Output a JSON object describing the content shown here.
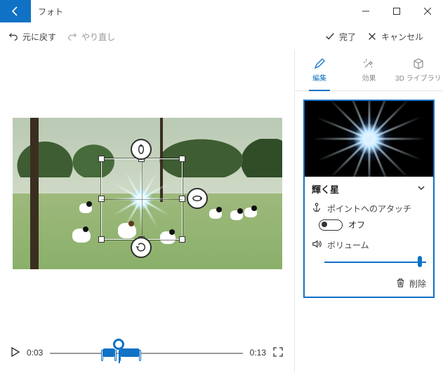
{
  "app_title": "フォト",
  "cmd": {
    "undo": "元に戻す",
    "redo": "やり直し",
    "done": "完了",
    "cancel": "キャンセル"
  },
  "timeline": {
    "current": "0:03",
    "total": "0:13"
  },
  "tabs": {
    "edit": "編集",
    "effects": "効果",
    "library3d": "3D ライブラリ"
  },
  "effect": {
    "name": "輝く星",
    "attach_label": "ポイントへのアタッチ",
    "toggle_state": "オフ",
    "volume_label": "ボリューム",
    "delete_label": "削除"
  }
}
